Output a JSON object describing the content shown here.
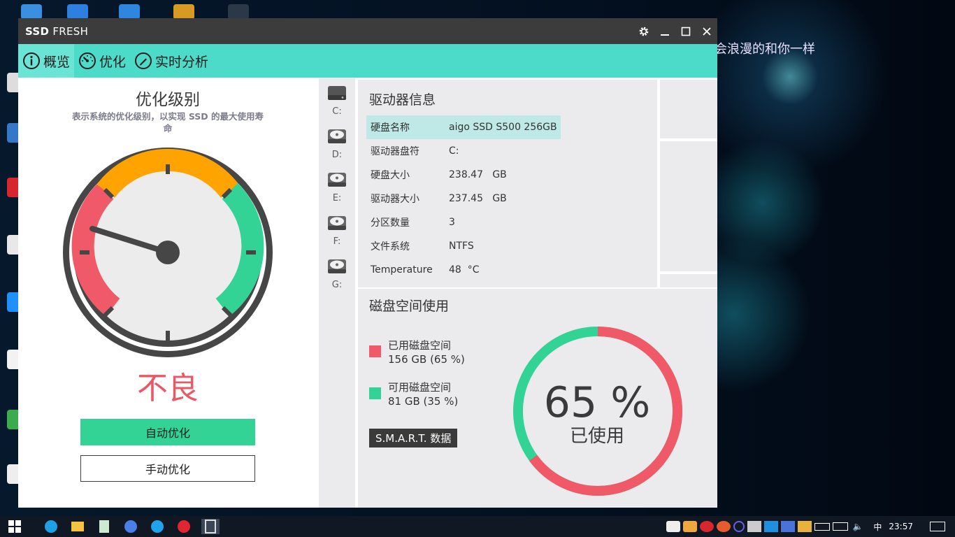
{
  "window": {
    "title_bold": "SSD",
    "title_rest": " FRESH"
  },
  "nav": {
    "tabs": [
      {
        "label": "概览"
      },
      {
        "label": "优化"
      },
      {
        "label": "实时分析"
      }
    ]
  },
  "optimization": {
    "title": "优化级别",
    "subtitle": "表示系统的优化级别，以实现 SSD 的最大使用寿命",
    "verdict": "不良",
    "auto_button": "自动优化",
    "manual_button": "手动优化"
  },
  "drives": [
    {
      "label": "C:"
    },
    {
      "label": "D:"
    },
    {
      "label": "E:"
    },
    {
      "label": "F:"
    },
    {
      "label": "G:"
    }
  ],
  "drive_info": {
    "title": "驱动器信息",
    "rows": [
      {
        "key": "硬盘名称",
        "value": "aigo SSD S500 256GB"
      },
      {
        "key": "驱动器盘符",
        "value": "C:"
      },
      {
        "key": "硬盘大小",
        "value": "238.47   GB"
      },
      {
        "key": "驱动器大小",
        "value": "237.45   GB"
      },
      {
        "key": "分区数量",
        "value": "3"
      },
      {
        "key": "文件系统",
        "value": "NTFS"
      },
      {
        "key": "Temperature",
        "value": "48  °C"
      }
    ]
  },
  "disk_usage": {
    "title": "磁盘空间使用",
    "used_label": "已用磁盘空间",
    "used_value": "156 GB (65 %)",
    "free_label": "可用磁盘空间",
    "free_value": "81 GB (35 %)",
    "smart_button": "S.M.A.R.T. 数据",
    "percent": "65 %",
    "percent_caption": "已使用",
    "used_fraction": 0.65,
    "used_color": "#f05a68",
    "free_color": "#33d395"
  },
  "wallpaper_text": "我的明天也会浪漫的和你一样",
  "taskbar": {
    "ime": "中",
    "time": "23:57"
  },
  "colors": {
    "accent": "#4ddbc9",
    "green": "#33d395",
    "red": "#f05a68",
    "orange": "#ffa300"
  }
}
